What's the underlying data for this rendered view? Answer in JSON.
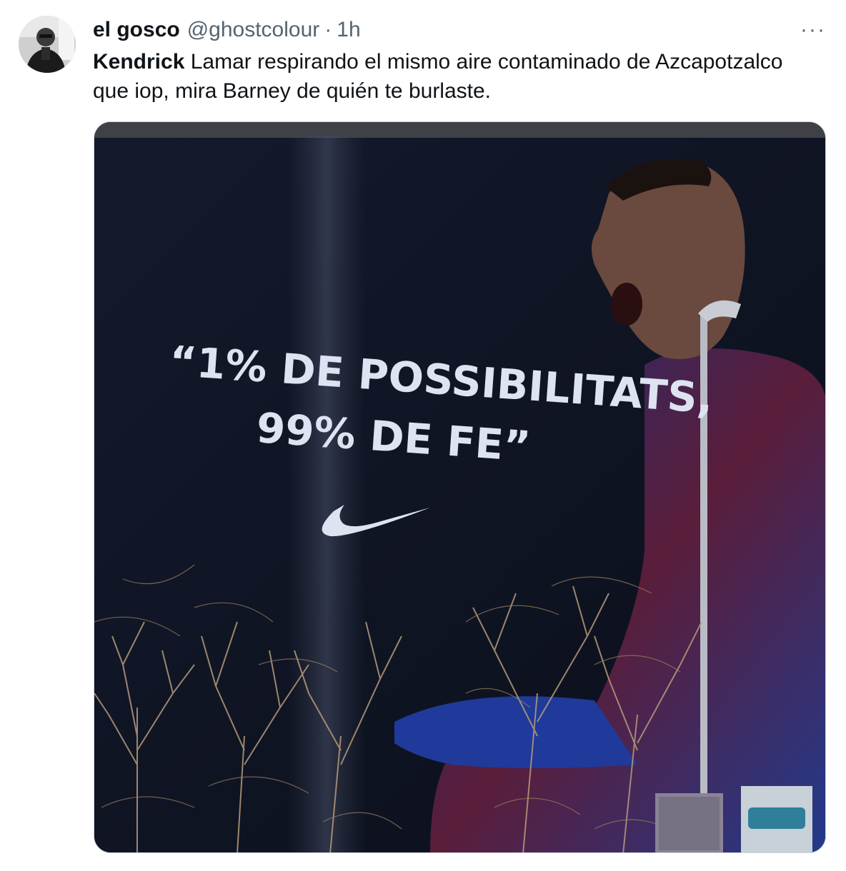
{
  "tweet": {
    "display_name": "el gosco",
    "handle": "@ghostcolour",
    "separator": "·",
    "time": "1h",
    "more_label": "···",
    "text_bold": "Kendrick",
    "text_rest": " Lamar respirando el mismo aire contaminado de Azcapotzalco que iop, mira Barney de quién te burlaste."
  },
  "media": {
    "billboard_line1": "“1% DE POSSIBILITATS,",
    "billboard_line2": "99% DE FE”"
  },
  "icons": {
    "more": "more-horizontal-icon",
    "brand": "swoosh-logo"
  },
  "colors": {
    "text_primary": "#0f1419",
    "text_secondary": "#536471",
    "border": "#cfd9de",
    "billboard_bg": "#0f1424"
  }
}
